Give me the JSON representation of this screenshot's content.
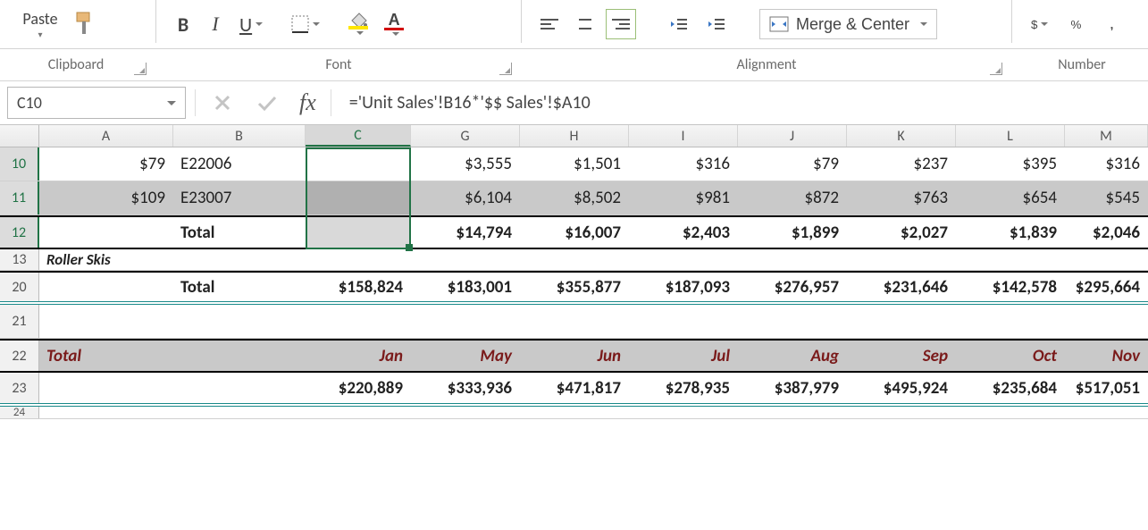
{
  "ribbon": {
    "paste_label": "Paste",
    "merge_label": "Merge & Center",
    "groups": {
      "clipboard": "Clipboard",
      "font": "Font",
      "alignment": "Alignment",
      "number": "Number"
    },
    "bold_label": "B",
    "italic_label": "I",
    "underline_label": "U",
    "fill_char": "A",
    "font_color_char": "A",
    "currency_char": "$",
    "percent_char": "%",
    "comma_char": ","
  },
  "formula_bar": {
    "name_box": "C10",
    "fx_label": "fx",
    "formula": "='Unit Sales'!B16*'$$ Sales'!$A10"
  },
  "columns": [
    {
      "id": "A",
      "label": "A",
      "cls": "wA"
    },
    {
      "id": "B",
      "label": "B",
      "cls": "wB"
    },
    {
      "id": "C",
      "label": "C",
      "cls": "wC",
      "selected": true
    },
    {
      "id": "G",
      "label": "G",
      "cls": "wG"
    },
    {
      "id": "H",
      "label": "H",
      "cls": "wH"
    },
    {
      "id": "I",
      "label": "I",
      "cls": "wI"
    },
    {
      "id": "J",
      "label": "J",
      "cls": "wJ"
    },
    {
      "id": "K",
      "label": "K",
      "cls": "wK"
    },
    {
      "id": "L",
      "label": "L",
      "cls": "wL"
    },
    {
      "id": "M",
      "label": "M",
      "cls": "wM"
    }
  ],
  "rows": {
    "r10": {
      "hdr": "10",
      "selected": true,
      "A": "$79",
      "B": "E22006",
      "C": "",
      "G": "$3,555",
      "H": "$1,501",
      "I": "$316",
      "J": "$79",
      "K": "$237",
      "L": "$395",
      "M": "$316"
    },
    "r11": {
      "hdr": "11",
      "selected": true,
      "A": "$109",
      "B": "E23007",
      "C": "",
      "G": "$6,104",
      "H": "$8,502",
      "I": "$981",
      "J": "$872",
      "K": "$763",
      "L": "$654",
      "M": "$545"
    },
    "r12": {
      "hdr": "12",
      "selected": true,
      "B": "Total",
      "G": "$14,794",
      "H": "$16,007",
      "I": "$2,403",
      "J": "$1,899",
      "K": "$2,027",
      "L": "$1,839",
      "M": "$2,046"
    },
    "r13": {
      "hdr": "13",
      "A": "Roller Skis"
    },
    "r20": {
      "hdr": "20",
      "B": "Total",
      "C": "$158,824",
      "G": "$183,001",
      "H": "$355,877",
      "I": "$187,093",
      "J": "$276,957",
      "K": "$231,646",
      "L": "$142,578",
      "M": "$295,664"
    },
    "r21": {
      "hdr": "21"
    },
    "r22": {
      "hdr": "22",
      "A": "Total",
      "C": "Jan",
      "G": "May",
      "H": "Jun",
      "I": "Jul",
      "J": "Aug",
      "K": "Sep",
      "L": "Oct",
      "M": "Nov"
    },
    "r23": {
      "hdr": "23",
      "C": "$220,889",
      "G": "$333,936",
      "H": "$471,817",
      "I": "$278,935",
      "J": "$387,979",
      "K": "$495,924",
      "L": "$235,684",
      "M": "$517,051"
    },
    "r24": {
      "hdr": "24"
    }
  }
}
